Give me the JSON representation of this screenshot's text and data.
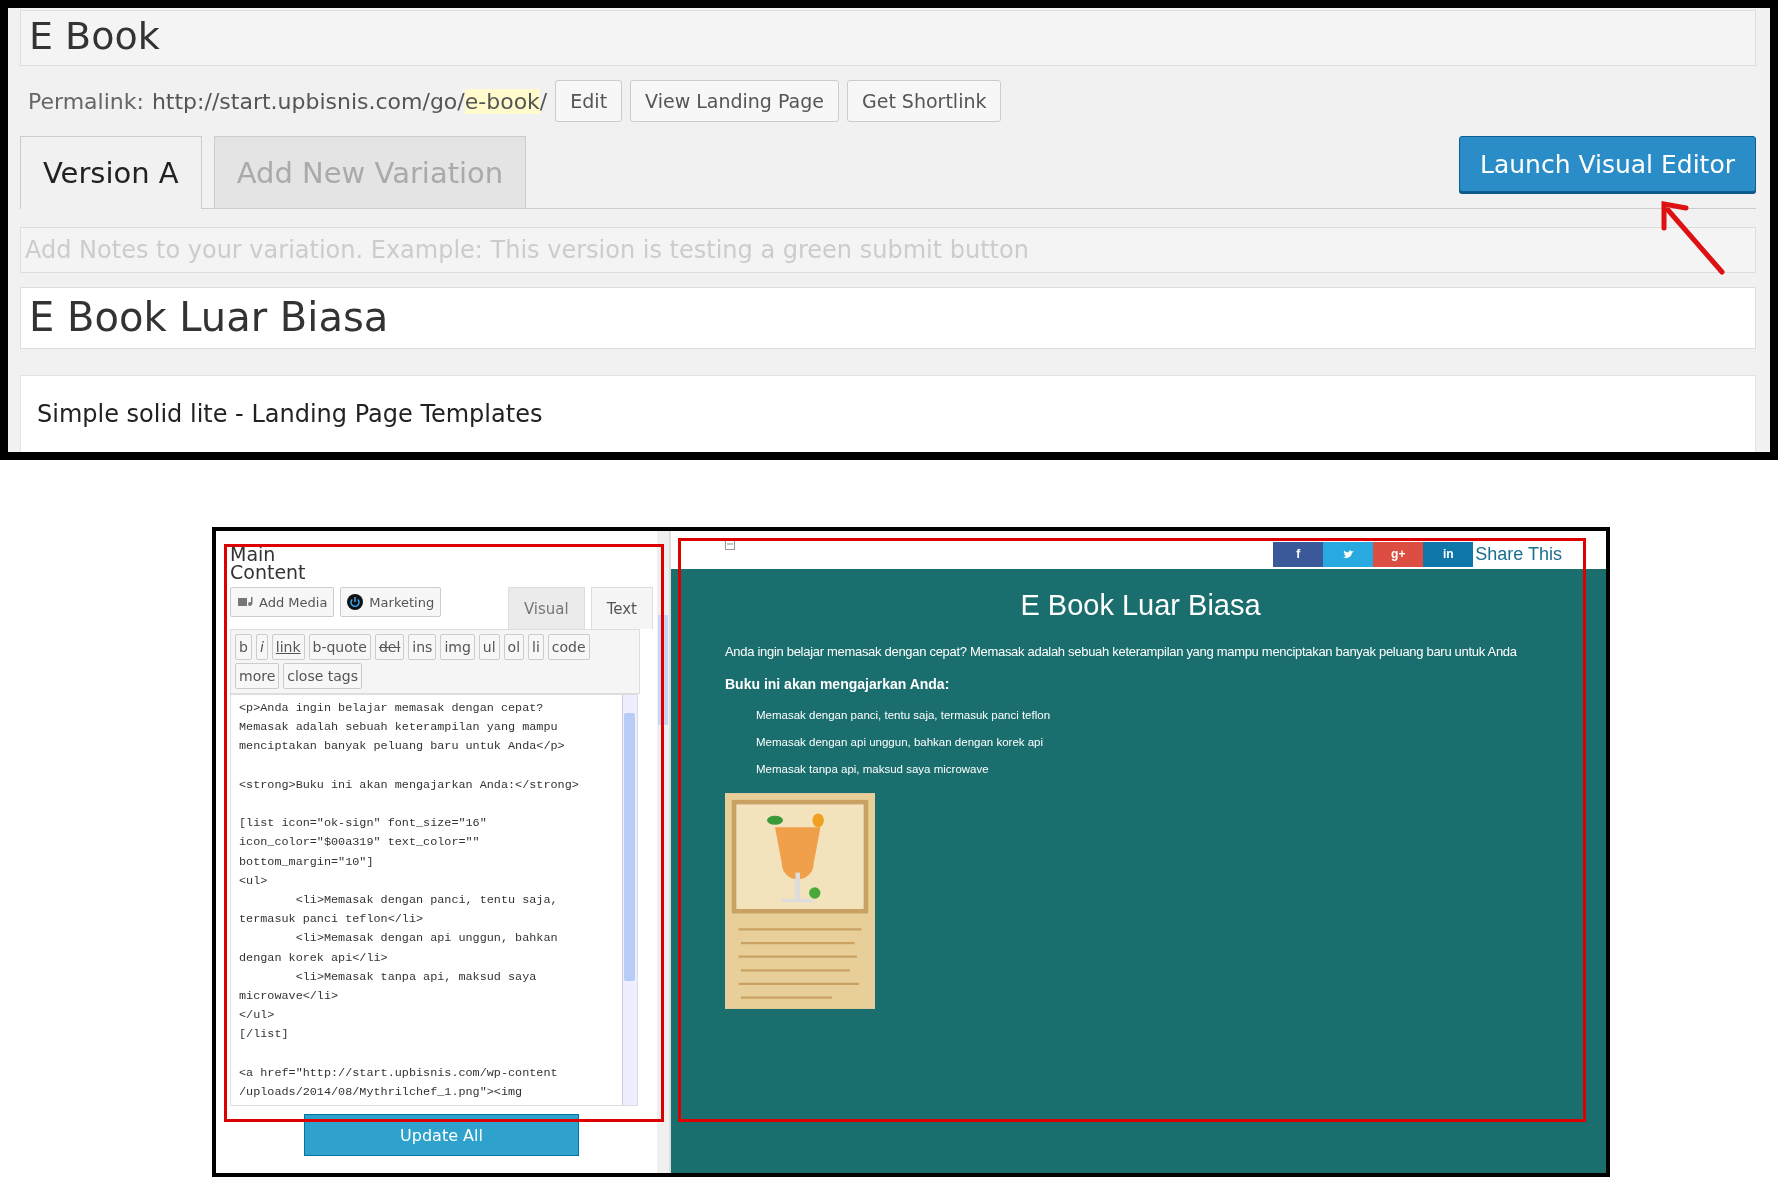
{
  "top": {
    "title": "E Book",
    "permalink": {
      "label": "Permalink:",
      "base": "http://start.upbisnis.com/go/",
      "slug": "e-book",
      "trail": "/"
    },
    "permalink_buttons": [
      "Edit",
      "View Landing Page",
      "Get Shortlink"
    ],
    "tabs": [
      {
        "label": "Version A",
        "selected": true
      },
      {
        "label": "Add New Variation",
        "selected": false
      }
    ],
    "launch_button": "Launch Visual Editor",
    "notes": {
      "placeholder": "Add Notes to your variation. Example: This version is testing a green submit button"
    },
    "page_title": "E Book Luar Biasa",
    "template": "Simple solid lite - Landing Page Templates"
  },
  "editor": {
    "heading": "Main\nContent",
    "media_buttons": [
      {
        "label": "Add Media",
        "kind": "media"
      },
      {
        "label": "Marketing",
        "kind": "power"
      }
    ],
    "tabs": [
      {
        "label": "Visual",
        "selected": false
      },
      {
        "label": "Text",
        "selected": true
      }
    ],
    "quicktags": [
      {
        "label": "b",
        "kind": "plain"
      },
      {
        "label": "i",
        "kind": "italic"
      },
      {
        "label": "link",
        "kind": "link"
      },
      {
        "label": "b-quote",
        "kind": "plain"
      },
      {
        "label": "del",
        "kind": "del"
      },
      {
        "label": "ins",
        "kind": "plain"
      },
      {
        "label": "img",
        "kind": "plain"
      },
      {
        "label": "ul",
        "kind": "plain"
      },
      {
        "label": "ol",
        "kind": "plain"
      },
      {
        "label": "li",
        "kind": "plain"
      },
      {
        "label": "code",
        "kind": "plain"
      },
      {
        "label": "more",
        "kind": "plain"
      },
      {
        "label": "close tags",
        "kind": "plain"
      }
    ],
    "code": "<p>Anda ingin belajar memasak dengan cepat?\nMemasak adalah sebuah keterampilan yang mampu\nmenciptakan banyak peluang baru untuk Anda</p>\n\n<strong>Buku ini akan mengajarkan Anda:</strong>\n\n[list icon=\"ok-sign\" font_size=\"16\"\nicon_color=\"$00a319\" text_color=\"\"\nbottom_margin=\"10\"]\n<ul>\n\t<li>Memasak dengan panci, tentu saja,\ntermasuk panci teflon</li>\n\t<li>Memasak dengan api unggun, bahkan\ndengan korek api</li>\n\t<li>Memasak tanpa api, maksud saya\nmicrowave</li>\n</ul>\n[/list]\n\n<a href=\"http://start.upbisnis.com/wp-content\n/uploads/2014/08/Mythrilchef_1.png\"><img",
    "update_button": "Update All"
  },
  "preview": {
    "share": [
      {
        "label": "f",
        "kind": "text",
        "color": "#3b5998"
      },
      {
        "kind": "bird",
        "color": "#28aae1"
      },
      {
        "label": "g+",
        "kind": "text",
        "color": "#dc4e41"
      },
      {
        "label": "in",
        "kind": "text",
        "color": "#0e76a8"
      }
    ],
    "share_label": "Share This",
    "heading": "E Book Luar Biasa",
    "intro": "Anda ingin belajar memasak dengan cepat? Memasak adalah sebuah keterampilan yang mampu menciptakan banyak peluang baru untuk Anda",
    "subheading": "Buku ini akan mengajarkan Anda:",
    "items": [
      "Memasak dengan panci, tentu saja, termasuk panci teflon",
      "Memasak dengan api unggun, bahkan dengan korek api",
      "Memasak tanpa api, maksud saya microwave"
    ],
    "image": {
      "kind": "picture"
    }
  }
}
